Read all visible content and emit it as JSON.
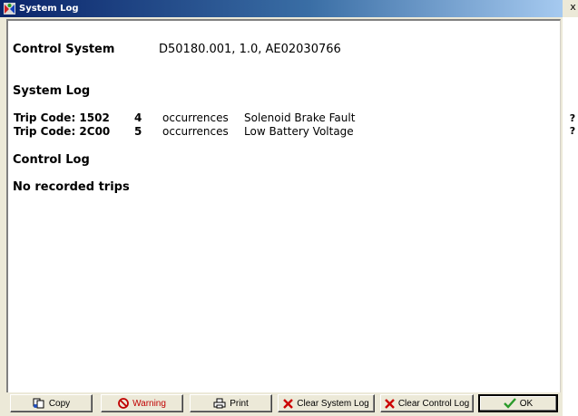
{
  "window": {
    "title": "System Log"
  },
  "header": {
    "control_system_label": "Control System",
    "control_system_value": "D50180.001, 1.0, AE02030766"
  },
  "system_log": {
    "heading": "System Log",
    "trips": [
      {
        "code": "Trip Code: 1502",
        "count": "4",
        "word": "occurrences",
        "description": "Solenoid Brake Fault"
      },
      {
        "code": "Trip Code: 2C00",
        "count": "5",
        "word": "occurrences",
        "description": "Low Battery Voltage"
      }
    ]
  },
  "control_log": {
    "heading": "Control Log",
    "empty_text": "No recorded trips"
  },
  "side": {
    "help1": "?",
    "help2": "?",
    "close": "x"
  },
  "buttons": {
    "copy": "Copy",
    "warning": "Warning",
    "print": "Print",
    "clear_system": "Clear System Log",
    "clear_control": "Clear Control Log",
    "ok": "OK"
  },
  "colors": {
    "title_gradient_start": "#0a246a",
    "warning_text": "#c00000",
    "clear_x": "#cc0000",
    "ok_check": "#2a9a2a"
  }
}
